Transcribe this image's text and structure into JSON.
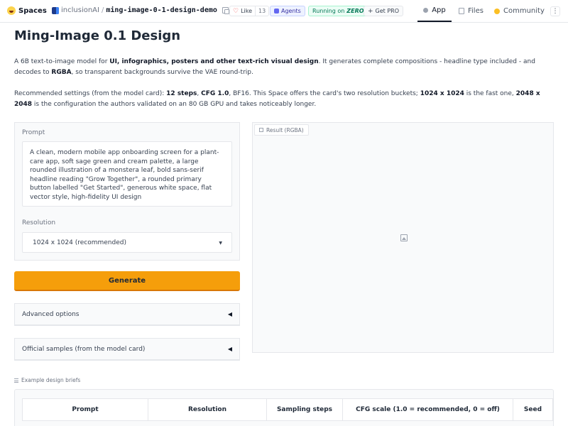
{
  "topbar": {
    "brand": "Spaces",
    "org": "inclusionAI",
    "separator": "/",
    "repo": "ming-image-0-1-design-demo",
    "like_label": "Like",
    "like_count": "13",
    "agents_label": "Agents",
    "running_label": "Running on",
    "zero_label": "ZERO",
    "pro_label": "Get PRO",
    "nav": {
      "app": "App",
      "files": "Files",
      "community": "Community"
    },
    "more": "⋮"
  },
  "main": {
    "title": "Ming-Image 0.1 Design",
    "intro": {
      "t1": "A 6B text-to-image model for ",
      "b1": "UI, infographics, posters and other text-rich visual design",
      "t2": ". It generates complete compositions - headline type included - and decodes to ",
      "b2": "RGBA",
      "t3": ", so transparent backgrounds survive the VAE round-trip."
    },
    "settings": {
      "t1": "Recommended settings (from the model card): ",
      "b1": "12 steps",
      "t2": ", ",
      "b2": "CFG 1.0",
      "t3": ", BF16. This Space offers the card's two resolution buckets; ",
      "b3": "1024 x 1024",
      "t4": " is the fast one, ",
      "b4": "2048 x 2048",
      "t5": " is the configuration the authors validated on an 80 GB GPU and takes noticeably longer."
    },
    "prompt": {
      "label": "Prompt",
      "value": "A clean, modern mobile app onboarding screen for a plant-care app, soft sage green and cream palette, a large rounded illustration of a monstera leaf, bold sans-serif headline reading \"Grow Together\", a rounded primary button labelled \"Get Started\", generous white space, flat vector style, high-fidelity UI design"
    },
    "resolution": {
      "label": "Resolution",
      "selected": "1024 x 1024 (recommended)"
    },
    "generate_label": "Generate",
    "advanced_label": "Advanced options",
    "samples_label": "Official samples (from the model card)",
    "accordion_icon": "◀",
    "result_label": "Result (RGBA)",
    "examples": {
      "label": "Example design briefs",
      "headers": [
        "Prompt",
        "Resolution",
        "Sampling steps",
        "CFG scale (1.0 = recommended, 0 = off)",
        "Seed"
      ]
    }
  },
  "icons": [
    "spaces-logo-icon",
    "org-logo-icon",
    "copy-icon",
    "heart-icon",
    "agents-icon",
    "plus-icon",
    "app-icon",
    "files-icon",
    "community-icon",
    "caret-down-icon",
    "image-placeholder-icon",
    "list-icon"
  ],
  "colors": {
    "accent": "#f59e0b",
    "zero_green": "#047857",
    "heart": "#ef4444"
  }
}
